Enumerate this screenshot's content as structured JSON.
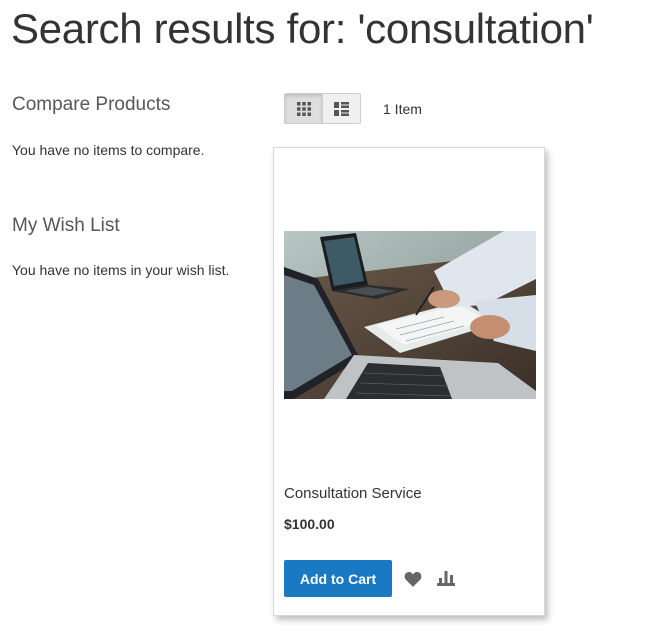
{
  "page": {
    "title": "Search results for: 'consultation'"
  },
  "sidebar": {
    "compare": {
      "title": "Compare Products",
      "empty_text": "You have no items to compare."
    },
    "wishlist": {
      "title": "My Wish List",
      "empty_text": "You have no items in your wish list."
    }
  },
  "toolbar": {
    "view_modes": [
      {
        "name": "Grid",
        "icon": "grid-icon",
        "active": true
      },
      {
        "name": "List",
        "icon": "list-icon",
        "active": false
      }
    ],
    "amount": "1 Item"
  },
  "products": [
    {
      "name": "Consultation Service",
      "price": "$100.00",
      "add_to_cart_label": "Add to Cart",
      "image": "laptops-and-paperwork-photo",
      "actions": [
        "heart-icon",
        "compare-icon"
      ]
    }
  ],
  "colors": {
    "primary": "#1979c3",
    "text": "#333333",
    "icon": "#666666"
  }
}
